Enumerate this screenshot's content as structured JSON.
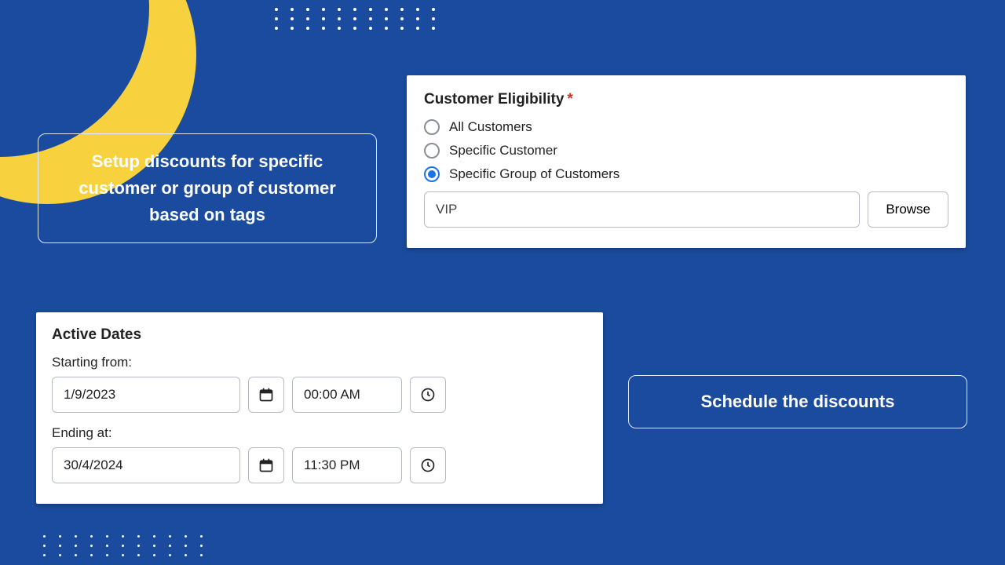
{
  "callouts": {
    "left": "Setup discounts for  specific customer or group of customer based on tags",
    "right": "Schedule the discounts"
  },
  "eligibility": {
    "heading": "Customer Eligibility",
    "required_marker": "*",
    "options": [
      {
        "label": "All Customers"
      },
      {
        "label": "Specific Customer"
      },
      {
        "label": "Specific Group of Customers"
      }
    ],
    "selected_index": 2,
    "tag_value": "VIP",
    "browse_label": "Browse"
  },
  "dates": {
    "heading": "Active Dates",
    "start_label": "Starting from:",
    "start_date": "1/9/2023",
    "start_time": "00:00 AM",
    "end_label": "Ending at:",
    "end_date": "30/4/2024",
    "end_time": "11:30 PM"
  },
  "icons": {
    "calendar": "calendar-icon",
    "clock": "clock-icon"
  }
}
